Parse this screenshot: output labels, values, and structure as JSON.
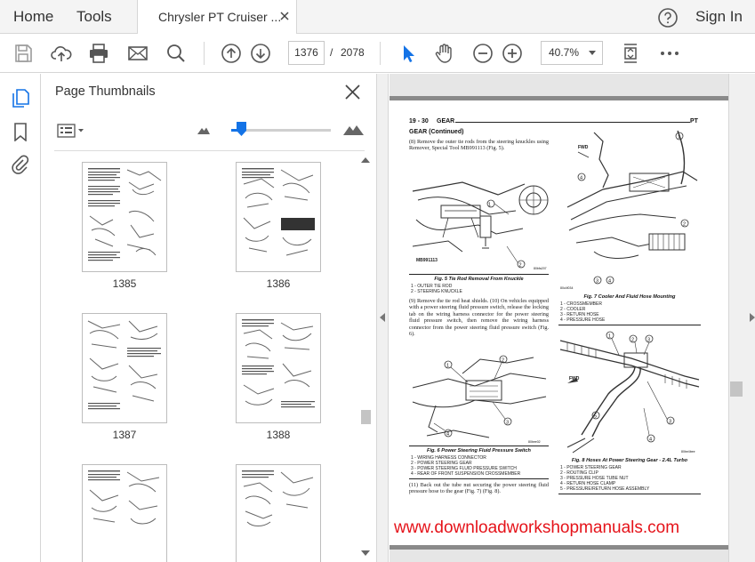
{
  "menu": {
    "home": "Home",
    "tools": "Tools",
    "doc_tab_title": "Chrysler PT Cruiser ...",
    "sign_in": "Sign In"
  },
  "toolbar": {
    "current_page": "1376",
    "page_separator": "/",
    "total_pages": "2078",
    "zoom": "40.7%"
  },
  "panel": {
    "title": "Page Thumbnails",
    "thumbnail_size": 0.1,
    "thumbnails": [
      {
        "label": "1385"
      },
      {
        "label": "1386"
      },
      {
        "label": "1387"
      },
      {
        "label": "1388"
      },
      {
        "label": ""
      },
      {
        "label": ""
      }
    ]
  },
  "page": {
    "header_left": "19 - 30",
    "header_mid": "GEAR",
    "header_right": "PT",
    "section_title": "GEAR (Continued)",
    "step8": "(8) Remove the outer tie rods from the steering knuckles using Remover, Special Tool MB991113 (Fig. 5).",
    "fig5_caption": "Fig. 5 Tie Rod Removal From Knuckle",
    "fig5_legend": [
      "1 - OUTER TIE ROD",
      "2 - STEERING KNUCKLE"
    ],
    "fig5_tool": "MB991113",
    "steps_9_10": "(9) Remove the tie rod heat shields. (10) On vehicles equipped with a power steering fluid pressure switch, release the locking tab on the wiring harness connector for the power steering fluid pressure switch, then remove the wiring harness connector from the power steering fluid pressure switch (Fig. 6).",
    "fig6_caption": "Fig. 6 Power Steering Fluid Pressure Switch",
    "fig6_legend": [
      "1 - WIRING HARNESS CONNECTOR",
      "2 - POWER STEERING GEAR",
      "3 - POWER STEERING FLUID PRESSURE SWITCH",
      "4 - REAR OF FRONT SUSPENSION CROSSMEMBER"
    ],
    "step11": "(11) Back out the tube nut securing the power steering fluid pressure hose to the gear (Fig. 7) (Fig. 8).",
    "fig7_caption": "Fig. 7 Cooler And Fluid Hose Mounting",
    "fig7_legend": [
      "1 - CROSSMEMBER",
      "2 - COOLER",
      "3 - RETURN HOSE",
      "4 - PRESSURE HOSE"
    ],
    "fig7_fwd": "FWD",
    "fig8_caption": "Fig. 8 Hoses At Power Steering Gear - 2.4L Turbo",
    "fig8_legend": [
      "1 - POWER STEERING GEAR",
      "2 - ROUTING CLIP",
      "3 - PRESSURE HOSE TUBE NUT",
      "4 - RETURN HOSE CLAMP",
      "5 - PRESSURE/RETURN HOSE ASSEMBLY"
    ],
    "fig8_fwd": "FWD"
  },
  "watermark": "www.downloadworkshopmanuals.com",
  "colors": {
    "accent": "#1473e6",
    "watermark": "#e5131a",
    "select_tool": "#1473e6"
  }
}
